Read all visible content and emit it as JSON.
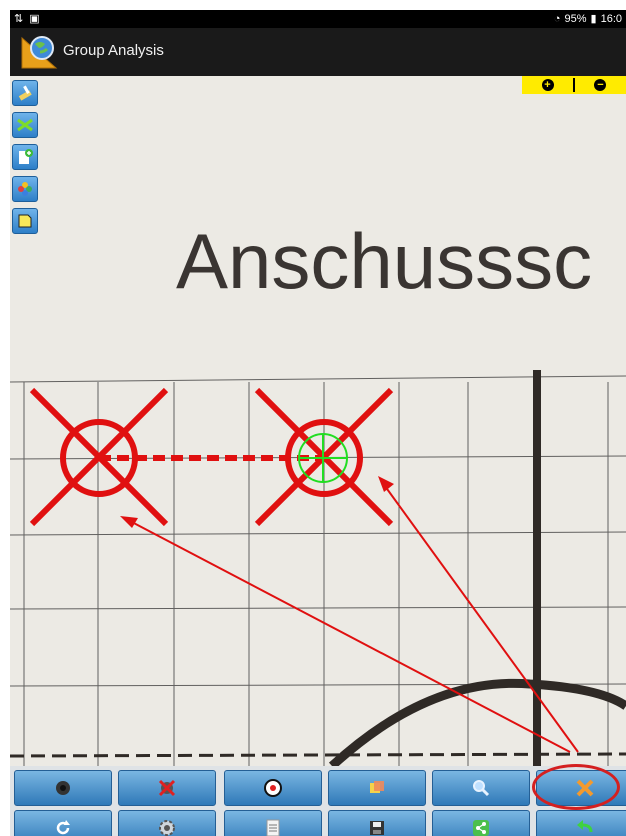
{
  "status_bar": {
    "battery": "95%",
    "time": "16:0"
  },
  "app_bar": {
    "title": "Group Analysis"
  },
  "target": {
    "heading": "Anschusssc"
  },
  "zoom": {
    "in_icon": "plus-circle-icon",
    "out_icon": "minus-circle-icon"
  },
  "left_tools": [
    {
      "name": "brush-tool",
      "icon": "brush-icon"
    },
    {
      "name": "shuffle-tool",
      "icon": "shuffle-icon"
    },
    {
      "name": "new-document-tool",
      "icon": "add-document-icon"
    },
    {
      "name": "photos-tool",
      "icon": "photos-icon"
    },
    {
      "name": "note-tool",
      "icon": "note-icon"
    }
  ],
  "toolbar": {
    "row1": [
      "bullet-hole-icon",
      "remove-shot-icon",
      "target-center-icon",
      "notes-icon",
      "magnify-icon",
      "measure-tool-icon"
    ],
    "row2": [
      "refresh-icon",
      "settings-icon",
      "report-icon",
      "save-icon",
      "share-icon",
      "undo-icon"
    ]
  },
  "colors": {
    "accent_red": "#e01010",
    "crosshair_green": "#22dd22",
    "zoom_yellow": "#ffeb00",
    "button_blue": "#2f79b8"
  }
}
